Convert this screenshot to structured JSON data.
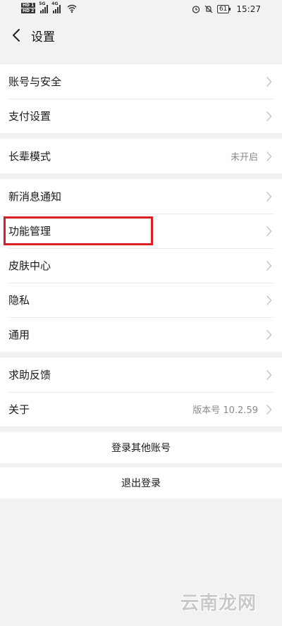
{
  "status_bar": {
    "sim1": "HD 1",
    "sim2": "HD 2",
    "net1": "5G",
    "net2": "4G",
    "battery": "61",
    "time": "15:27"
  },
  "header": {
    "title": "设置",
    "back_icon": "chevron-left-icon"
  },
  "groups": {
    "account": [
      {
        "label": "账号与安全"
      },
      {
        "label": "支付设置"
      }
    ],
    "elder": [
      {
        "label": "长辈模式",
        "value": "未开启"
      }
    ],
    "general": [
      {
        "label": "新消息通知"
      },
      {
        "label": "功能管理"
      },
      {
        "label": "皮肤中心"
      },
      {
        "label": "隐私"
      },
      {
        "label": "通用"
      }
    ],
    "help": [
      {
        "label": "求助反馈"
      },
      {
        "label": "关于",
        "value": "版本号 10.2.59"
      }
    ]
  },
  "actions": {
    "switch_account": "登录其他账号",
    "logout": "退出登录"
  },
  "highlight": {
    "target": "功能管理",
    "color": "#d81f26"
  },
  "watermark": "云南龙网",
  "colors": {
    "page_bg": "#f2f2f2",
    "card_bg": "#ffffff",
    "secondary_text": "#8a8a8a",
    "highlight": "#d81f26"
  }
}
